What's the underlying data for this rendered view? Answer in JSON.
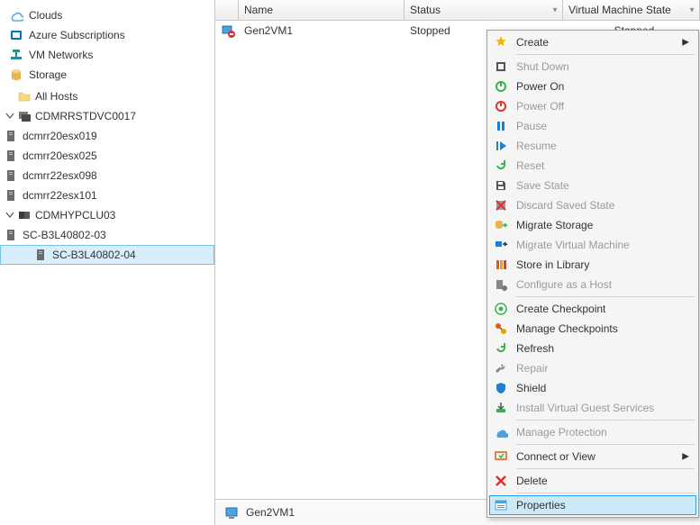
{
  "sidebar": {
    "nav": [
      {
        "label": "Clouds",
        "icon": "cloud-icon",
        "color": "#2ea3d8"
      },
      {
        "label": "Azure Subscriptions",
        "icon": "azure-icon",
        "color": "#0072c6"
      },
      {
        "label": "VM Networks",
        "icon": "network-icon",
        "color": "#00a39b"
      },
      {
        "label": "Storage",
        "icon": "storage-icon",
        "color": "#e8b54f"
      }
    ],
    "tree_root_label": "All Hosts",
    "hosts": [
      {
        "label": "CDMRRSTDVC0017",
        "children": [
          {
            "label": "dcmrr20esx019"
          },
          {
            "label": "dcmrr20esx025"
          },
          {
            "label": "dcmrr22esx098"
          },
          {
            "label": "dcmrr22esx101"
          }
        ]
      },
      {
        "label": "CDMHYPCLU03",
        "children": [
          {
            "label": "SC-B3L40802-03"
          },
          {
            "label": "SC-B3L40802-04",
            "selected": true
          }
        ]
      }
    ]
  },
  "grid": {
    "columns": {
      "name": "Name",
      "status": "Status",
      "vmstate": "Virtual Machine State"
    },
    "rows": [
      {
        "name": "Gen2VM1",
        "status": "Stopped",
        "vmstate": "Stopped"
      }
    ]
  },
  "footer": {
    "label": "Gen2VM1"
  },
  "menu": {
    "items": [
      {
        "label": "Create",
        "icon": "star-icon",
        "color": "#f7b500",
        "submenu": true
      },
      {
        "sep": true
      },
      {
        "label": "Shut Down",
        "icon": "shutdown-icon",
        "color": "#555",
        "disabled": true
      },
      {
        "label": "Power On",
        "icon": "poweron-icon",
        "color": "#37b24d"
      },
      {
        "label": "Power Off",
        "icon": "poweroff-icon",
        "color": "#e03131",
        "disabled": true
      },
      {
        "label": "Pause",
        "icon": "pause-icon",
        "color": "#1c7ed6",
        "disabled": true
      },
      {
        "label": "Resume",
        "icon": "resume-icon",
        "color": "#1c7ed6",
        "disabled": true
      },
      {
        "label": "Reset",
        "icon": "reset-icon",
        "color": "#37b24d",
        "disabled": true
      },
      {
        "label": "Save State",
        "icon": "save-icon",
        "color": "#555",
        "disabled": true
      },
      {
        "label": "Discard Saved State",
        "icon": "discard-icon",
        "color": "#e03131",
        "disabled": true
      },
      {
        "label": "Migrate Storage",
        "icon": "migrate-storage-icon",
        "color": "#37b24d"
      },
      {
        "label": "Migrate Virtual Machine",
        "icon": "migrate-vm-icon",
        "color": "#1c7ed6",
        "disabled": true
      },
      {
        "label": "Store in Library",
        "icon": "library-icon",
        "color": "#e8590c"
      },
      {
        "label": "Configure as a Host",
        "icon": "configure-host-icon",
        "color": "#888",
        "disabled": true
      },
      {
        "sep": true
      },
      {
        "label": "Create Checkpoint",
        "icon": "checkpoint-icon",
        "color": "#37b24d"
      },
      {
        "label": "Manage Checkpoints",
        "icon": "manage-checkpoint-icon",
        "color": "#e8590c"
      },
      {
        "label": "Refresh",
        "icon": "refresh-icon",
        "color": "#37b24d"
      },
      {
        "label": "Repair",
        "icon": "repair-icon",
        "color": "#888",
        "disabled": true
      },
      {
        "label": "Shield",
        "icon": "shield-icon",
        "color": "#1c7ed6"
      },
      {
        "label": "Install Virtual Guest Services",
        "icon": "install-icon",
        "color": "#37b24d",
        "disabled": true
      },
      {
        "sep": true
      },
      {
        "label": "Manage Protection",
        "icon": "protection-icon",
        "color": "#4aa3df",
        "disabled": true
      },
      {
        "sep": true
      },
      {
        "label": "Connect or View",
        "icon": "connect-icon",
        "color": "#e8590c",
        "submenu": true
      },
      {
        "sep": true
      },
      {
        "label": "Delete",
        "icon": "delete-icon",
        "color": "#e03131"
      },
      {
        "sep": true
      },
      {
        "label": "Properties",
        "icon": "properties-icon",
        "color": "#4aa3df",
        "selected": true
      }
    ]
  }
}
